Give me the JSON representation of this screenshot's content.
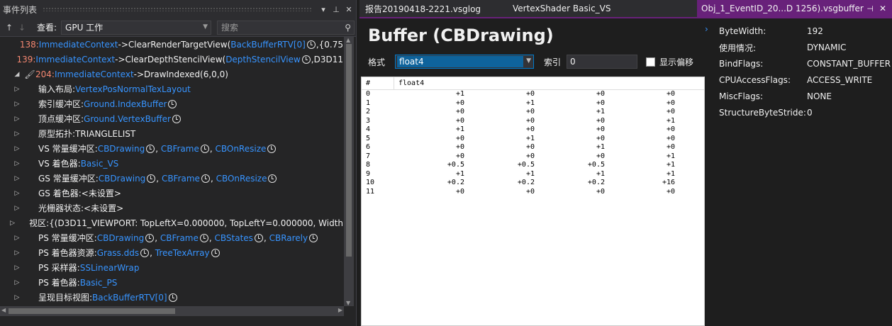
{
  "left_panel": {
    "title": "事件列表",
    "view_label": "查看:",
    "view_value": "GPU 工作",
    "search_placeholder": "搜索",
    "rows": [
      {
        "num": "138:",
        "ctx": "ImmediateContext",
        "arrow": "->",
        "call": "ClearRenderTargetView(",
        "arg": "BackBufferRTV[0]",
        "rest": ",{0.75"
      },
      {
        "num": "139:",
        "ctx": "ImmediateContext",
        "arrow": "->",
        "call": "ClearDepthStencilView(",
        "arg": "DepthStencilView",
        "rest": ",D3D11"
      },
      {
        "num": "204:",
        "ctx": "ImmediateContext",
        "arrow": "->",
        "call": "DrawIndexed(6,0,0)"
      }
    ],
    "children": [
      {
        "label": "输入布局:",
        "links": [
          "VertexPosNormalTexLayout"
        ],
        "clock": false
      },
      {
        "label": "索引缓冲区:",
        "links": [
          "Ground.IndexBuffer"
        ],
        "clock": true
      },
      {
        "label": "顶点缓冲区:",
        "links": [
          "Ground.VertexBuffer"
        ],
        "clock": true
      },
      {
        "label": "原型拓扑:TRIANGLELIST",
        "links": [],
        "clock": false
      },
      {
        "label": "VS 常量缓冲区:",
        "links": [
          "CBDrawing",
          "CBFrame",
          "CBOnResize"
        ],
        "clock": true
      },
      {
        "label": "VS 着色器:",
        "links": [
          "Basic_VS"
        ],
        "clock": false
      },
      {
        "label": "GS 常量缓冲区:",
        "links": [
          "CBDrawing",
          "CBFrame",
          "CBOnResize"
        ],
        "clock": true
      },
      {
        "label": "GS 着色器:<未设置>",
        "links": [],
        "clock": false
      },
      {
        "label": "光栅器状态:<未设置>",
        "links": [],
        "clock": false
      },
      {
        "label": "视区:{(D3D11_VIEWPORT: TopLeftX=0.000000, TopLeftY=0.000000, Width",
        "links": [],
        "clock": false
      },
      {
        "label": "PS 常量缓冲区:",
        "links": [
          "CBDrawing",
          "CBFrame",
          "CBStates",
          "CBRarely"
        ],
        "clock": true
      },
      {
        "label": "PS 着色器资源:",
        "links": [
          "Grass.dds",
          "TreeTexArray"
        ],
        "clock": true
      },
      {
        "label": "PS 采样器:",
        "links": [
          "SSLinearWrap"
        ],
        "clock": false
      },
      {
        "label": "PS 着色器:",
        "links": [
          "Basic_PS"
        ],
        "clock": false
      },
      {
        "label": "呈现目标视图:",
        "links": [
          "BackBufferRTV[0]"
        ],
        "clock": true
      }
    ]
  },
  "tabs": [
    {
      "label": "报告20190418-2221.vsglog"
    },
    {
      "label": "VertexShader Basic_VS"
    },
    {
      "label": "Obj_1_EventID_20...D 1256).vsgbuffer"
    }
  ],
  "buffer": {
    "title": "Buffer (CBDrawing)",
    "format_label": "格式",
    "format_value": "float4",
    "index_label": "索引",
    "index_value": "0",
    "show_offset_label": "显示偏移",
    "columns": [
      "#",
      "float4"
    ],
    "rows": [
      [
        "0",
        "+1",
        "+0",
        "+0",
        "+0"
      ],
      [
        "1",
        "+0",
        "+1",
        "+0",
        "+0"
      ],
      [
        "2",
        "+0",
        "+0",
        "+1",
        "+0"
      ],
      [
        "3",
        "+0",
        "+0",
        "+0",
        "+1"
      ],
      [
        "4",
        "+1",
        "+0",
        "+0",
        "+0"
      ],
      [
        "5",
        "+0",
        "+1",
        "+0",
        "+0"
      ],
      [
        "6",
        "+0",
        "+0",
        "+1",
        "+0"
      ],
      [
        "7",
        "+0",
        "+0",
        "+0",
        "+1"
      ],
      [
        "8",
        "+0.5",
        "+0.5",
        "+0.5",
        "+1"
      ],
      [
        "9",
        "+1",
        "+1",
        "+1",
        "+1"
      ],
      [
        "10",
        "+0.2",
        "+0.2",
        "+0.2",
        "+16"
      ],
      [
        "11",
        "+0",
        "+0",
        "+0",
        "+0"
      ]
    ]
  },
  "properties": [
    {
      "key": "ByteWidth:",
      "value": "192"
    },
    {
      "key": "使用情况:",
      "value": "DYNAMIC"
    },
    {
      "key": "BindFlags:",
      "value": "CONSTANT_BUFFER"
    },
    {
      "key": "CPUAccessFlags:",
      "value": "ACCESS_WRITE"
    },
    {
      "key": "MiscFlags:",
      "value": "NONE"
    },
    {
      "key": "StructureByteStride:",
      "value": "0"
    }
  ],
  "colors": {
    "accent": "#68217a",
    "link": "#3794ff",
    "event_number": "#f48771"
  }
}
